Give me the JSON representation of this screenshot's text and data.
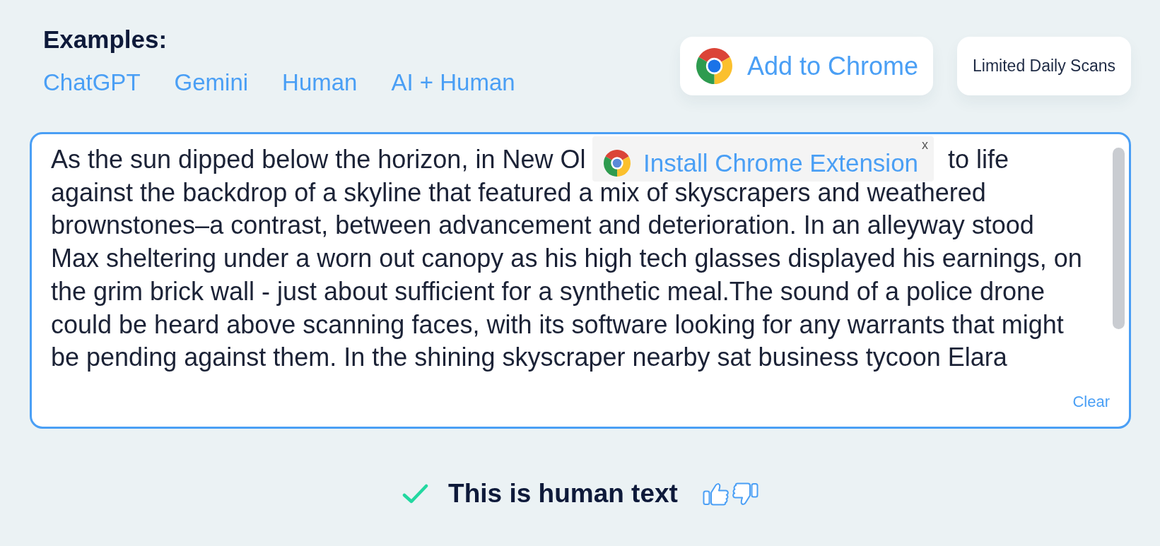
{
  "examples": {
    "title": "Examples:",
    "links": [
      "ChatGPT",
      "Gemini",
      "Human",
      "AI + Human"
    ]
  },
  "actions": [
    {
      "kind": "extension",
      "label": "Add to Chrome"
    },
    {
      "kind": "plain",
      "label": "Limited Daily Scans"
    }
  ],
  "editor": {
    "first_line": [
      "As the sun dipped below the horizon, in New Ol",
      "to life"
    ],
    "lines": [
      "against the backdrop of a skyline that featured a mix of skyscrapers and weathered",
      "brownstones–a contrast, between advancement and deterioration. In an alleyway stood",
      "Max sheltering under a worn out canopy as his high tech glasses displayed his earnings, on",
      "the grim brick wall - just about sufficient for a synthetic meal.The sound of a police drone",
      "could be heard above scanning faces, with its software looking for any warrants that might",
      "be pending against them. In the shining skyscraper nearby sat business tycoon Elara"
    ],
    "clear_label": "Clear"
  },
  "extension_banner": {
    "label": "Install Chrome Extension",
    "close_label": "x"
  },
  "result": {
    "verdict": "This is human text"
  }
}
